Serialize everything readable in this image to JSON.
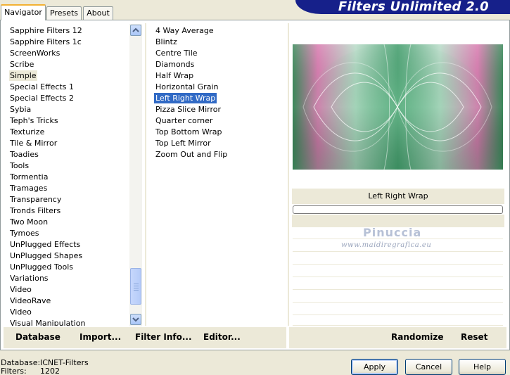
{
  "tabs": [
    {
      "label": "Navigator",
      "active": true
    },
    {
      "label": "Presets",
      "active": false
    },
    {
      "label": "About",
      "active": false
    }
  ],
  "app_title": "Filters Unlimited 2.0",
  "categories": [
    "Sapphire Filters 12",
    "Sapphire Filters 1c",
    "ScreenWorks",
    "Scribe",
    "Simple",
    "Special Effects 1",
    "Special Effects 2",
    "Sybia",
    "Teph's Tricks",
    "Texturize",
    "Tile & Mirror",
    "Toadies",
    "Tools",
    "Tormentia",
    "Tramages",
    "Transparency",
    "Tronds Filters",
    "Two Moon",
    "Tymoes",
    "UnPlugged Effects",
    "UnPlugged Shapes",
    "UnPlugged Tools",
    "Variations",
    "Video",
    "VideoRave",
    "Video",
    "Visual Manipulation"
  ],
  "selected_category": "Simple",
  "filters": [
    "4 Way Average",
    "Blintz",
    "Centre Tile",
    "Diamonds",
    "Half Wrap",
    "Horizontal Grain",
    "Left Right Wrap",
    "Pizza Slice Mirror",
    "Quarter corner",
    "Top Bottom Wrap",
    "Top Left Mirror",
    "Zoom Out and Flip"
  ],
  "selected_filter": "Left Right Wrap",
  "preview": {
    "filter_name": "Left Right Wrap",
    "watermark_name": "Pinuccia",
    "watermark_url": "www.maidiregrafica.eu",
    "colors": {
      "pink": "#e07fb2",
      "green": "#2f8a55",
      "mint": "#a8d8c0"
    }
  },
  "actions": {
    "database": "Database",
    "import": "Import...",
    "filter_info": "Filter Info...",
    "editor": "Editor...",
    "randomize": "Randomize",
    "reset": "Reset"
  },
  "status": {
    "database_label": "Database:",
    "database_value": "ICNET-Filters",
    "filters_label": "Filters:",
    "filters_value": "1202"
  },
  "buttons": {
    "apply": "Apply",
    "cancel": "Cancel",
    "help": "Help"
  },
  "colors": {
    "selection": "#316ac5",
    "banner": "#16208a",
    "face": "#ece9d8"
  }
}
